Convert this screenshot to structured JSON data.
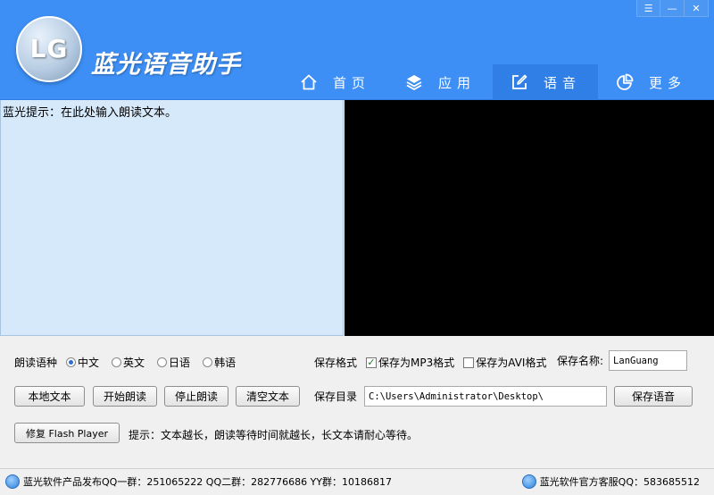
{
  "app": {
    "logo_text": "LG",
    "title": "蓝光语音助手"
  },
  "window_controls": {
    "menu": "☰",
    "minimize": "—",
    "close": "✕"
  },
  "nav": [
    {
      "label": "首页",
      "icon": "home-icon"
    },
    {
      "label": "应用",
      "icon": "layers-icon"
    },
    {
      "label": "语音",
      "icon": "edit-icon",
      "active": true
    },
    {
      "label": "更多",
      "icon": "pie-chart-icon"
    }
  ],
  "text_area": {
    "hint": "蓝光提示：在此处输入朗读文本。"
  },
  "voice": {
    "label": "朗读语种",
    "options": [
      "中文",
      "英文",
      "日语",
      "韩语"
    ],
    "selected": "中文"
  },
  "save_format": {
    "label": "保存格式",
    "mp3_label": "保存为MP3格式",
    "mp3_checked": true,
    "avi_label": "保存为AVI格式",
    "avi_checked": false
  },
  "save_name": {
    "label": "保存名称:",
    "value": "LanGuang"
  },
  "buttons": {
    "local_text": "本地文本",
    "start_read": "开始朗读",
    "stop_read": "停止朗读",
    "clear_text": "清空文本",
    "save_voice": "保存语音",
    "repair_flash": "修复 Flash Player"
  },
  "save_dir": {
    "label": "保存目录",
    "value": "C:\\Users\\Administrator\\Desktop\\"
  },
  "tip": "提示：文本越长，朗读等待时间就越长，长文本请耐心等待。",
  "status": {
    "left": "蓝光软件产品发布QQ一群：251065222 QQ二群：282776686 YY群：10186817",
    "right": "蓝光软件官方客服QQ：583685512"
  },
  "colors": {
    "header": "#3d8ff5",
    "nav_active": "#2f7fe6",
    "text_bg": "#d6e9fb",
    "video_bg": "#000000"
  }
}
